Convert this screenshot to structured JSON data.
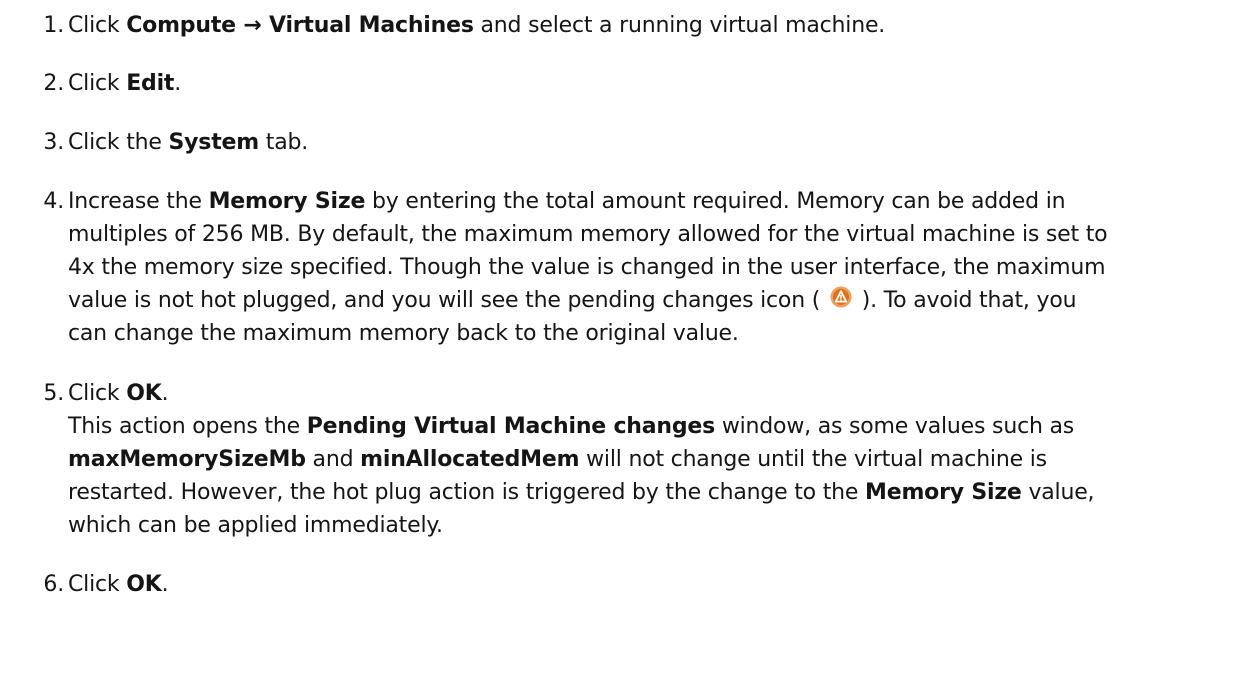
{
  "steps": [
    {
      "num": "1.",
      "t1": "Click ",
      "b1": "Compute → Virtual Machines",
      "t2": " and select a running virtual machine."
    },
    {
      "num": "2.",
      "t1": "Click ",
      "b1": "Edit",
      "t2": "."
    },
    {
      "num": "3.",
      "t1": "Click the ",
      "b1": "System",
      "t2": " tab."
    },
    {
      "num": "4.",
      "l1_t1": "Increase the ",
      "l1_b1": "Memory Size",
      "l1_t2": " by entering the total amount required. Memory can be added in",
      "l2": "multiples of 256 MB. By default, the maximum memory allowed for the virtual machine is set to",
      "l3": "4x the memory size specified. Though the value is changed in the user interface, the maximum",
      "l4_t1": "value is not hot plugged, and you will see the pending changes icon ( ",
      "l4_t2": " ). To avoid that, you",
      "l5": "can change the maximum memory back to the original value."
    },
    {
      "num": "5.",
      "t1": "Click ",
      "b1": "OK",
      "t2": ".",
      "l2_t1": "This action opens the ",
      "l2_b1": "Pending Virtual Machine changes",
      "l2_t2": " window, as some values such as",
      "l3_b1": "maxMemorySizeMb",
      "l3_t1": " and ",
      "l3_b2": "minAllocatedMem",
      "l3_t2": " will not change until the virtual machine is",
      "l4_t1": "restarted. However, the hot plug action is triggered by the change to the ",
      "l4_b1": "Memory Size",
      "l4_t2": " value,",
      "l5": "which can be applied immediately."
    },
    {
      "num": "6.",
      "t1": "Click ",
      "b1": "OK",
      "t2": "."
    }
  ],
  "icon": {
    "name": "pending-changes-icon",
    "colors": {
      "outer": "#f0a05a",
      "inner": "#e0721c",
      "mark": "#ffffff"
    }
  }
}
